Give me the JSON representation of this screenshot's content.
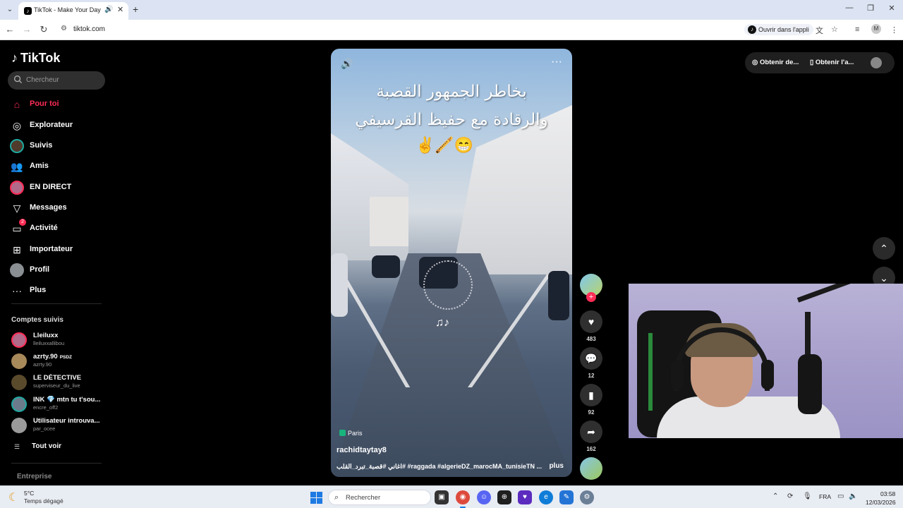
{
  "browser": {
    "tab_title": "TikTok - Make Your Day",
    "url": "tiktok.com",
    "open_in_app": "Ouvrir dans l'appli",
    "profile_initial": "M"
  },
  "sidebar": {
    "logo": "TikTok",
    "search_placeholder": "Chercheur",
    "nav": [
      {
        "label": "Pour toi",
        "icon": "home-icon",
        "active": true
      },
      {
        "label": "Explorateur",
        "icon": "compass-icon"
      },
      {
        "label": "Suivis",
        "icon": "following-avatar"
      },
      {
        "label": "Amis",
        "icon": "friends-icon"
      },
      {
        "label": "EN DIRECT",
        "icon": "live-avatar"
      },
      {
        "label": "Messages",
        "icon": "send-icon"
      },
      {
        "label": "Activité",
        "icon": "inbox-icon",
        "badge": "2"
      },
      {
        "label": "Importateur",
        "icon": "upload-icon"
      },
      {
        "label": "Profil",
        "icon": "profile-avatar"
      },
      {
        "label": "Plus",
        "icon": "more-icon"
      }
    ],
    "followed_title": "Comptes suivis",
    "accounts": [
      {
        "name": "Lleiluxx",
        "user": "lleiluxxallibou"
      },
      {
        "name": "azrty.90",
        "tag": "PSDZ",
        "user": "azrty.90"
      },
      {
        "name": "LE DÉTECTIVE",
        "user": "superviseur_du_live"
      },
      {
        "name": "INK 💎 mtn tu t'sou...",
        "user": "encre_off2"
      },
      {
        "name": "Utilisateur introuva...",
        "user": "par_ocee"
      }
    ],
    "see_all": "Tout voir",
    "footer": "Entreprise"
  },
  "video": {
    "caption_line1": "بخاطر الجمهور القصبة",
    "caption_line2": "والرقادة مع حفيظ القرسيفي",
    "caption_emoji": "✌️🪈😁",
    "location": "Paris",
    "author": "rachidtaytay8",
    "description": "اغاني #قصبة_تبرد_القلب# #raggada #algerieDZ_marocMA_tunisieTN ...",
    "more": "plus"
  },
  "rail": {
    "likes": "483",
    "comments": "12",
    "saves": "92",
    "shares": "162"
  },
  "top": {
    "get_coins": "Obtenir de...",
    "get_app": "Obtenir l'a..."
  },
  "taskbar": {
    "temperature": "5°C",
    "weather": "Temps dégagé",
    "search": "Rechercher",
    "language": "FRA",
    "time": "03:58",
    "date": "12/03/2026"
  },
  "colors": {
    "accent": "#fe2c55",
    "background": "#000000"
  }
}
